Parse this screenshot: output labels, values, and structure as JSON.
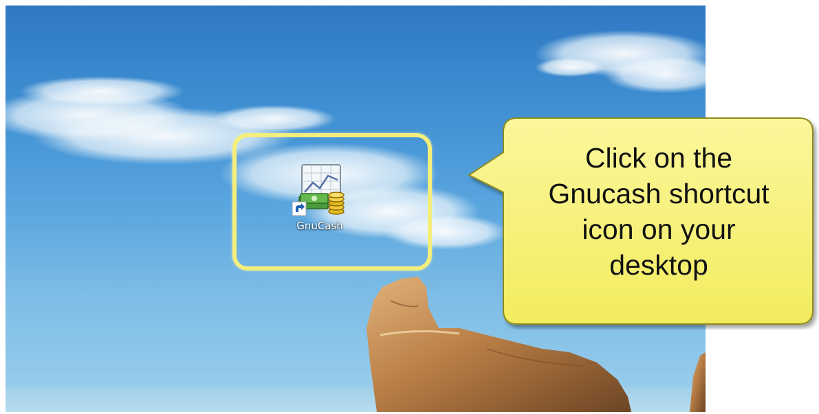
{
  "desktop": {
    "shortcut": {
      "label": "GnuCash",
      "icon": "gnucash-icon"
    }
  },
  "callout": {
    "lines": [
      "Click on the",
      "Gnucash shortcut",
      "icon on your",
      "desktop"
    ]
  },
  "colors": {
    "highlight_border": "#f4ee7a",
    "callout_fill": "#f7f27a",
    "callout_border": "#8f8a1e"
  }
}
